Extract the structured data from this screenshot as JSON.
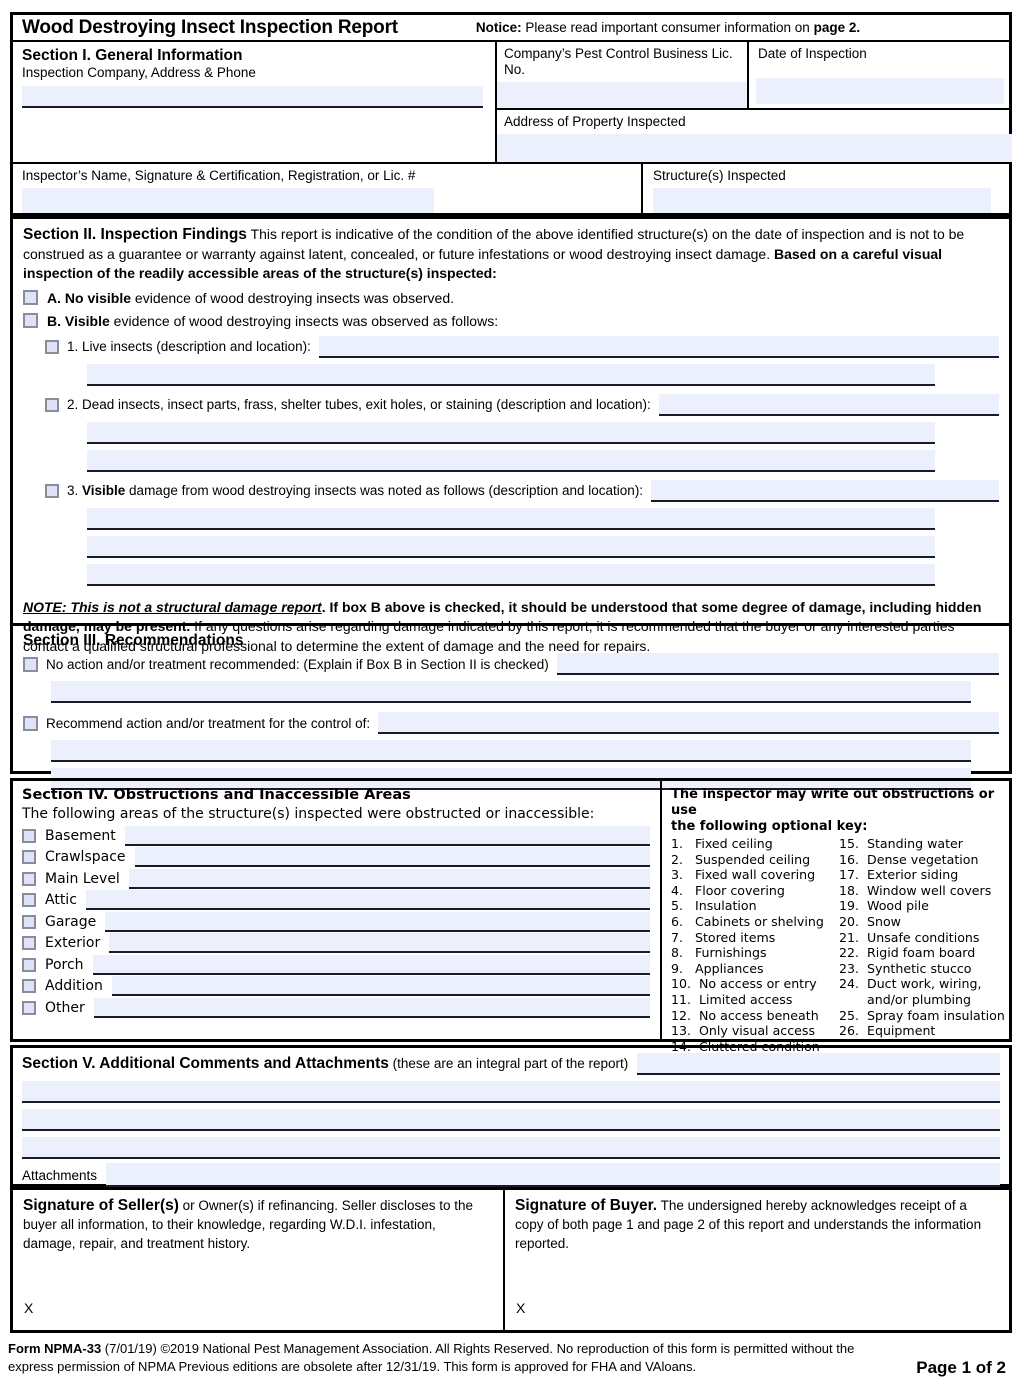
{
  "header": {
    "title": "Wood Destroying Insect Inspection Report",
    "notice_label": "Notice:",
    "notice_text": " Please read important consumer information on ",
    "notice_bold_tail": "page 2."
  },
  "section1": {
    "heading": "Section I. General Information",
    "company_label": "Inspection Company, Address & Phone",
    "license_label": "Company’s Pest Control Business Lic. No.",
    "date_label": "Date of Inspection",
    "address_label": "Address of Property Inspected",
    "inspector_label": "Inspector’s Name, Signature & Certification, Registration, or Lic. #",
    "structures_label": "Structure(s) Inspected",
    "company_value": "",
    "license_value": "",
    "date_value": "",
    "address_value": "",
    "inspector_value": "",
    "structures_value": ""
  },
  "section2": {
    "heading": "Section II. Inspection Findings",
    "intro_1": " This report is indicative of the condition of the above identified structure(s) on the date of inspection and is not to be construed as a guarantee or warranty against latent, concealed, or future infestations or wood destroying insect damage. ",
    "intro_bold": "Based on a careful visual inspection of the readily accessible areas of the structure(s) inspected:",
    "option_a_bold": "A. No visible",
    "option_a_rest": " evidence of wood destroying insects was observed.",
    "option_b_bold": "B. Visible",
    "option_b_rest": " evidence of wood destroying insects was observed as follows:",
    "item1": "1. Live insects (description and location):",
    "item2": "2. Dead insects, insect parts, frass, shelter tubes, exit holes, or staining (description and location):",
    "item3_pre": "3. ",
    "item3_bold": "Visible",
    "item3_rest": " damage from wood destroying insects was noted as follows (description and location):",
    "note_underline": "NOTE: This is not a structural damage report",
    "note_bold": ". If box B above is checked, it should be understood that some degree of damage, including hidden damage, may be present.",
    "note_rest": " If any questions arise regarding damage indicated by this report, it is recommended that the buyer or any interested parties contact a qualified structural professional to determine the extent of damage and the need for repairs."
  },
  "section3": {
    "heading": "Section III. Recommendations",
    "option_no_action": "No action and/or treatment recommended: (Explain if Box B in Section II is checked)",
    "option_recommend": "Recommend action and/or treatment for the control of:"
  },
  "section4": {
    "heading": "Section IV. Obstructions and Inaccessible Areas",
    "subheading": "The following areas of the structure(s) inspected were obstructed or inaccessible:",
    "areas": [
      {
        "label": "Basement",
        "value": ""
      },
      {
        "label": "Crawlspace",
        "value": ""
      },
      {
        "label": "Main Level",
        "value": ""
      },
      {
        "label": "Attic",
        "value": ""
      },
      {
        "label": "Garage",
        "value": ""
      },
      {
        "label": "Exterior",
        "value": ""
      },
      {
        "label": "Porch",
        "value": ""
      },
      {
        "label": "Addition",
        "value": ""
      },
      {
        "label": "Other",
        "value": ""
      }
    ],
    "key_heading_line1": "The inspector may write out obstructions or use",
    "key_heading_line2": "the following optional key:",
    "key_col1": [
      {
        "n": "1.",
        "t": "Fixed ceiling"
      },
      {
        "n": "2.",
        "t": "Suspended ceiling"
      },
      {
        "n": "3.",
        "t": "Fixed wall covering"
      },
      {
        "n": "4.",
        "t": "Floor covering"
      },
      {
        "n": "5.",
        "t": "Insulation"
      },
      {
        "n": "6.",
        "t": "Cabinets or shelving"
      },
      {
        "n": "7.",
        "t": "Stored items"
      },
      {
        "n": "8.",
        "t": "Furnishings"
      },
      {
        "n": "9.",
        "t": "Appliances"
      },
      {
        "n": "10.",
        "t": "No access or entry"
      },
      {
        "n": "11.",
        "t": "Limited access"
      },
      {
        "n": "12.",
        "t": "No access beneath"
      },
      {
        "n": "13.",
        "t": "Only visual access"
      },
      {
        "n": "14.",
        "t": "Cluttered condition"
      }
    ],
    "key_col2": [
      {
        "n": "15.",
        "t": "Standing water"
      },
      {
        "n": "16.",
        "t": "Dense vegetation"
      },
      {
        "n": "17.",
        "t": "Exterior siding"
      },
      {
        "n": "18.",
        "t": "Window well covers"
      },
      {
        "n": "19.",
        "t": "Wood pile"
      },
      {
        "n": "20.",
        "t": "Snow"
      },
      {
        "n": "21.",
        "t": "Unsafe conditions"
      },
      {
        "n": "22.",
        "t": "Rigid foam board"
      },
      {
        "n": "23.",
        "t": "Synthetic stucco"
      },
      {
        "n": "24.",
        "t": "Duct work, wiring,"
      },
      {
        "n": "",
        "t": "and/or plumbing"
      },
      {
        "n": "25.",
        "t": "Spray foam insulation"
      },
      {
        "n": "26.",
        "t": "Equipment"
      }
    ]
  },
  "section5": {
    "heading": "Section V. Additional Comments and Attachments",
    "heading_note": " (these are an integral part of the report)",
    "attachments_label": "Attachments"
  },
  "signatures": {
    "seller_bold": "Signature of Seller(s)",
    "seller_rest": " or Owner(s) if refinancing. Seller discloses to the buyer all information, to their knowledge, regarding W.D.I. infestation, damage, repair, and treatment history.",
    "buyer_bold": "Signature of Buyer.",
    "buyer_rest": " The undersigned hereby acknowledges receipt of a copy of both page 1 and page 2 of this report and understands the information reported.",
    "seller_x": "X",
    "buyer_x": "X"
  },
  "footer": {
    "form_bold": "Form NPMA-33",
    "form_rest": " (7/01/19) ©2019 National Pest Management Association. All Rights Reserved. No reproduction of this form is permitted without the express permission of NPMA Previous editions are obsolete after 12/31/19. This form is approved for FHA and VAloans.",
    "page_label": "Page 1 of 2"
  },
  "colors": {
    "field_fill": "#eceffc",
    "checkbox_fill": "#dfe3f7",
    "checkbox_border": "#8b8b9c",
    "rule": "#1a1a2b"
  }
}
